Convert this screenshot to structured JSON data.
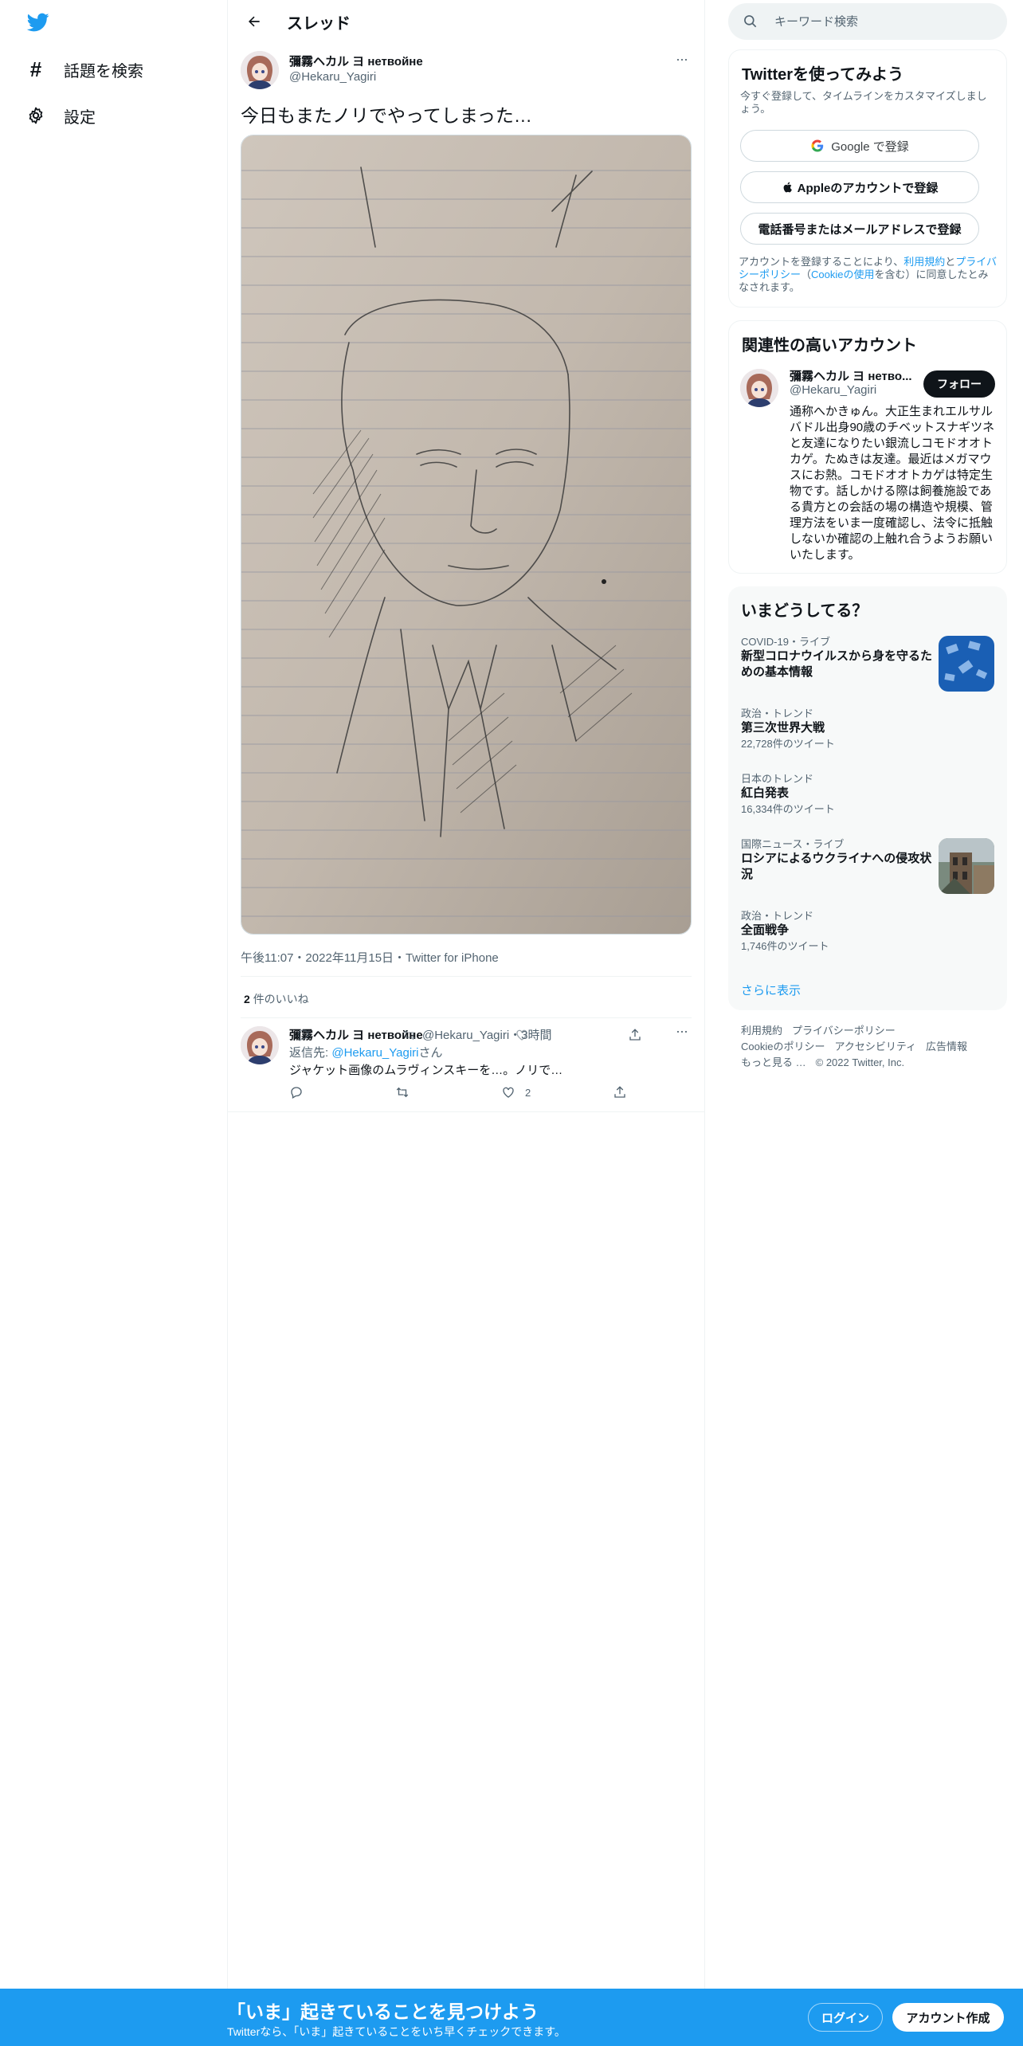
{
  "nav": {
    "explore_label": "話題を検索",
    "settings_label": "設定"
  },
  "header": {
    "title": "スレッド"
  },
  "tweet": {
    "name": "彌霧ヘカル ヨ нетвойне",
    "handle": "@Hekaru_Yagiri",
    "text": "今日もまたノリでやってしまった…",
    "meta": "午後11:07・2022年11月15日・Twitter for iPhone",
    "likes_count": "2",
    "likes_label": "件のいいね"
  },
  "reply": {
    "name": "彌霧ヘカル ヨ нетвойне",
    "handle": "@Hekaru_Yagiri",
    "time": "・3時間",
    "reply_to_prefix": "返信先: ",
    "reply_to_handle": "@Hekaru_Yagiri",
    "reply_to_suffix": "さん",
    "text": "ジャケット画像のムラヴィンスキーを…。ノリで…",
    "like_count": "2"
  },
  "search": {
    "placeholder": "キーワード検索"
  },
  "signup": {
    "title": "Twitterを使ってみよう",
    "subtitle": "今すぐ登録して、タイムラインをカスタマイズしましょう。",
    "google_button": "Google で登録",
    "apple_button": "Appleのアカウントで登録",
    "phone_button": "電話番号またはメールアドレスで登録",
    "legal_prefix": "アカウントを登録することにより、",
    "legal_terms": "利用規約",
    "legal_and": "と",
    "legal_privacy": "プライバシーポリシー",
    "legal_open": "（",
    "legal_cookie": "Cookieの使用",
    "legal_suffix": "を含む）に同意したとみなされます。"
  },
  "related": {
    "title": "関連性の高いアカウント",
    "name": "彌霧ヘカル ヨ нетво...",
    "handle": "@Hekaru_Yagiri",
    "follow_label": "フォロー",
    "bio": "通称へかきゅん。大正生まれエルサルバドル出身90歳のチベットスナギツネと友達になりたい銀流しコモドオオトカゲ。たぬきは友達。最近はメガマウスにお熱。コモドオオトカゲは特定生物です。話しかける際は飼養施設である貴方との会話の場の構造や規模、管理方法をいま一度確認し、法令に抵触しないか確認の上触れ合うようお願いいたします。"
  },
  "trends": {
    "title": "いまどうしてる？",
    "items": [
      {
        "category": "COVID-19・ライブ",
        "title": "新型コロナウイルスから身を守るための基本情報",
        "count": ""
      },
      {
        "category": "政治・トレンド",
        "title": "第三次世界大戦",
        "count": "22,728件のツイート"
      },
      {
        "category": "日本のトレンド",
        "title": "紅白発表",
        "count": "16,334件のツイート"
      },
      {
        "category": "国際ニュース・ライブ",
        "title": "ロシアによるウクライナへの侵攻状況",
        "count": ""
      },
      {
        "category": "政治・トレンド",
        "title": "全面戦争",
        "count": "1,746件のツイート"
      }
    ],
    "show_more": "さらに表示"
  },
  "footer": {
    "links": [
      "利用規約",
      "プライバシーポリシー",
      "Cookieのポリシー",
      "アクセシビリティ",
      "広告情報",
      "もっと見る …",
      "© 2022 Twitter, Inc."
    ]
  },
  "bottom_bar": {
    "title": "「いま」起きていることを見つけよう",
    "subtitle": "Twitterなら、「いま」起きていることをいち早くチェックできます。",
    "login_label": "ログイン",
    "signup_label": "アカウント作成"
  },
  "colors": {
    "accent": "#1d9bf0",
    "text": "#0f1419",
    "secondary": "#536471"
  },
  "icons": [
    "twitter-logo-icon",
    "hashtag-icon",
    "gear-icon",
    "back-arrow-icon",
    "more-icon",
    "search-icon",
    "google-icon",
    "apple-icon",
    "reply-icon",
    "retweet-icon",
    "like-icon",
    "share-icon"
  ]
}
